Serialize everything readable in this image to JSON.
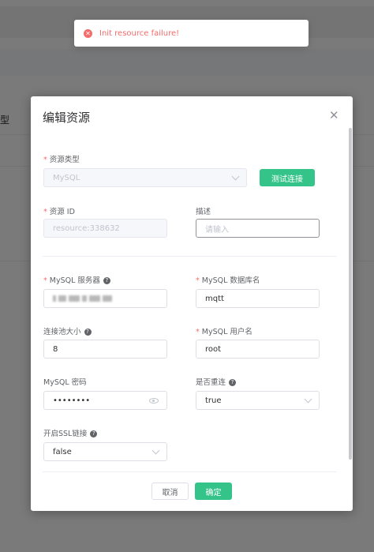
{
  "toast": {
    "message": "Init resource failure!",
    "icon": "error-circle-icon"
  },
  "background": {
    "column_header": "型"
  },
  "dialog": {
    "title": "编辑资源",
    "fields": {
      "resource_type": {
        "label": "资源类型",
        "value": "MySQL",
        "required": true
      },
      "test_button": "测试连接",
      "resource_id": {
        "label": "资源 ID",
        "value": "resource:338632",
        "required": true
      },
      "description": {
        "label": "描述",
        "placeholder": "请输入"
      },
      "mysql_server": {
        "label": "MySQL 服务器",
        "required": true
      },
      "mysql_database": {
        "label": "MySQL 数据库名",
        "value": "mqtt",
        "required": true
      },
      "pool_size": {
        "label": "连接池大小",
        "value": "8"
      },
      "mysql_user": {
        "label": "MySQL 用户名",
        "value": "root",
        "required": true
      },
      "mysql_password": {
        "label": "MySQL 密码",
        "value": "••••••••"
      },
      "auto_reconnect": {
        "label": "是否重连",
        "value": "true"
      },
      "ssl": {
        "label": "开启SSL链接",
        "value": "false"
      }
    },
    "buttons": {
      "cancel": "取消",
      "confirm": "确定"
    }
  },
  "colors": {
    "primary": "#34c388",
    "error": "#f56c6c",
    "required": "#f56c6c"
  }
}
